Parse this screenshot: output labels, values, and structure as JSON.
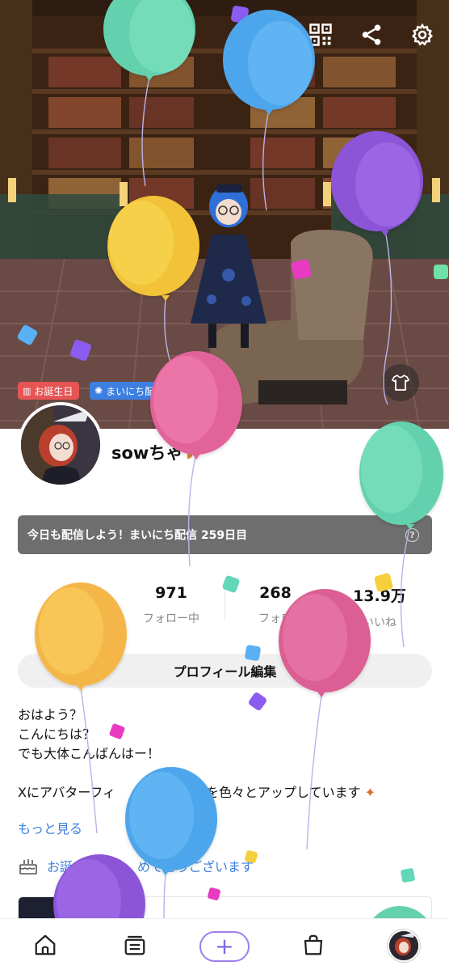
{
  "header": {
    "qr_icon": "qr-code-icon",
    "share_icon": "share-icon",
    "settings_icon": "gear-icon"
  },
  "tags": {
    "birthday": "お誕生日",
    "daily": "まいにち配"
  },
  "profile": {
    "username": "sowちゃ",
    "banner_text": "今日も配信しよう！まいにち配信 259日目"
  },
  "stats": [
    {
      "value": "971",
      "label": "フォロー中"
    },
    {
      "value": "268",
      "label": "フォロ"
    },
    {
      "value": "13.9万",
      "label": "いいね"
    }
  ],
  "edit_profile_label": "プロフィール編集",
  "bio": {
    "lines": [
      "おはよう？",
      "こんにちは？",
      "でも大体こんばんはー！",
      "",
      "Xにアバターフィ",
      "ドを色々とアップしています"
    ],
    "more_label": "もっと見る"
  },
  "birthday_row": {
    "part1": "お誕",
    "part2": "めでとうございます"
  },
  "colors": {
    "accent": "#3c7fe0",
    "birthday_tag": "#e65454",
    "banner_bg": "#6e6e6e"
  }
}
